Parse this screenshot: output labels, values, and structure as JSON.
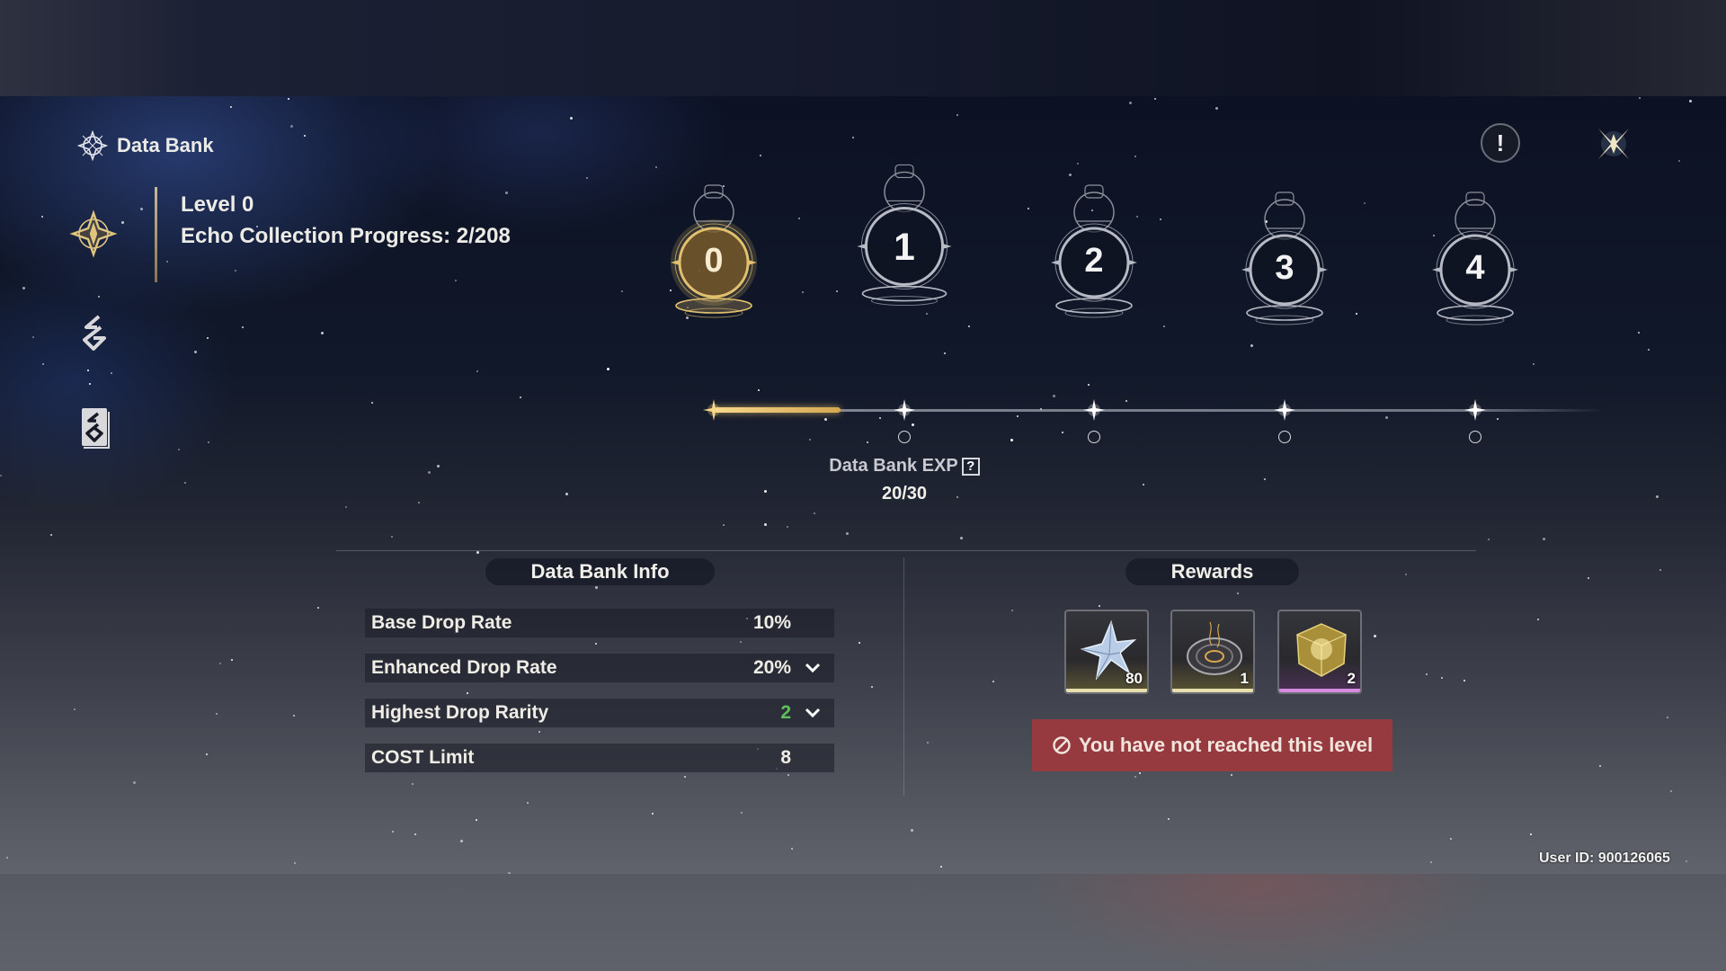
{
  "header": {
    "title": "Data Bank",
    "title_icon": "data-bank-emblem-icon",
    "info_icon": "exclamation-icon",
    "close_icon": "close-star-icon"
  },
  "sidebar": {
    "items": [
      {
        "name": "data-bank",
        "icon": "data-bank-emblem-icon",
        "active": true
      },
      {
        "name": "echo-tuning",
        "icon": "echo-glyph-icon",
        "active": false
      },
      {
        "name": "echo-catalog",
        "icon": "book-glyph-icon",
        "active": false
      }
    ]
  },
  "status": {
    "level": "Level 0",
    "echo_progress": "Echo Collection Progress: 2/208"
  },
  "timeline": {
    "levels": [
      {
        "label": "0",
        "state": "current"
      },
      {
        "label": "1",
        "state": "locked"
      },
      {
        "label": "2",
        "state": "locked"
      },
      {
        "label": "3",
        "state": "locked"
      },
      {
        "label": "4",
        "state": "locked"
      }
    ],
    "progress_fraction": 0.667,
    "exp_label": "Data Bank EXP",
    "exp_help": "?",
    "exp_value": "20/30"
  },
  "info": {
    "title": "Data Bank Info",
    "rows": [
      {
        "label": "Base Drop Rate",
        "value": "10%",
        "expandable": false
      },
      {
        "label": "Enhanced Drop Rate",
        "value": "20%",
        "expandable": true
      },
      {
        "label": "Highest Drop Rarity",
        "value": "2",
        "expandable": true,
        "highlight": "#5fbf5a"
      },
      {
        "label": "COST Limit",
        "value": "8",
        "expandable": false
      }
    ]
  },
  "rewards": {
    "title": "Rewards",
    "items": [
      {
        "name": "crystal-star",
        "qty": "80",
        "rarity_color": "#e8dfae"
      },
      {
        "name": "tuner-disc",
        "qty": "1",
        "rarity_color": "#e8dfae"
      },
      {
        "name": "golden-cube",
        "qty": "2",
        "rarity_color": "#d68be0"
      }
    ],
    "locked_message": "You have not reached this level",
    "locked_icon": "prohibited-icon",
    "locked_color": "#963a40"
  },
  "footer": {
    "user_id": "User ID: 900126065"
  }
}
